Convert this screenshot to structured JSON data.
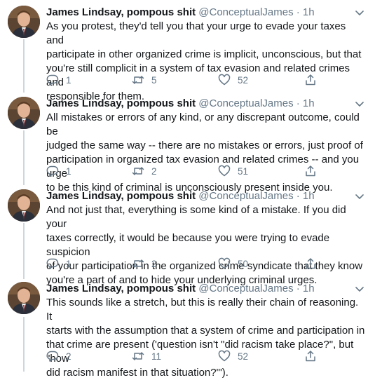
{
  "author": {
    "name": "James Lindsay, pompous shit",
    "handle": "@ConceptualJames",
    "separator": "·",
    "time": "1h"
  },
  "icons": {
    "reply": "reply-icon",
    "retweet": "retweet-icon",
    "like": "heart-icon",
    "share": "share-icon",
    "more": "chevron-down-icon"
  },
  "colors": {
    "text": "#14171a",
    "secondary": "#657786",
    "thread_line": "#ccd6dd"
  },
  "tweets": [
    {
      "text": "As you protest, they'd tell you that your urge to evade your taxes and\nparticipate in other organized crime is implicit, unconscious, but that\nyou're still complicit in a system of tax evasion and related crimes and\nresponsible for them.",
      "replies": "1",
      "retweets": "5",
      "likes": "52"
    },
    {
      "text": "All mistakes or errors of any kind, or any discrepant outcome, could be\njudged the same way -- there are no mistakes or errors, just proof of\nparticipation in organized tax evasion and related crimes -- and you urge\nto be this kind of criminal is unconsciously present inside you.",
      "replies": "1",
      "retweets": "2",
      "likes": "51"
    },
    {
      "text": "And not just that, everything is some kind of a mistake. If you did your\ntaxes correctly, it would be because you were trying to evade suspicion\nof your participation in the organized crime syndicate that they know\nyou're a part of and to hide your underlying criminal urges.",
      "replies": "1",
      "retweets": "2",
      "likes": "50"
    },
    {
      "text": "This sounds like a stretch, but this is really their chain of reasoning. It\nstarts with the assumption that a system of crime and participation in\nthat crime are present ('question isn't \"did racism take place?\", but \"how\ndid racism manifest in that situation?\"').",
      "replies": "2",
      "retweets": "11",
      "likes": "52"
    }
  ]
}
